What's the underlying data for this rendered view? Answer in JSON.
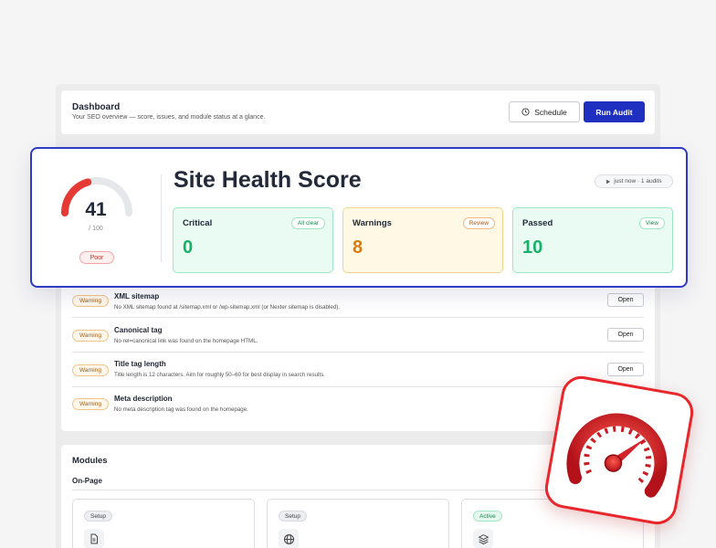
{
  "header": {
    "title": "Dashboard",
    "subtitle": "Your SEO overview — score, issues, and module status at a glance.",
    "schedule_label": "Schedule",
    "run_audit_label": "Run Audit"
  },
  "score": {
    "title": "Site Health Score",
    "value": "41",
    "max": "/ 100",
    "fraction": 0.41,
    "rating": "Poor",
    "meta": "just now · 1 audits",
    "stats": [
      {
        "label": "Critical",
        "value": "0",
        "pill": "All clear",
        "color": "#17b26a"
      },
      {
        "label": "Warnings",
        "value": "8",
        "pill": "Review",
        "color": "#db7a0b"
      },
      {
        "label": "Passed",
        "value": "10",
        "pill": "View",
        "color": "#17b26a"
      }
    ],
    "colors": {
      "accent": "#2f3ac7",
      "gauge_fill": "#e53935",
      "gauge_track": "#e6e7ea"
    }
  },
  "issues": [
    {
      "badge": "Warning",
      "title": "XML sitemap",
      "desc": "No XML sitemap found at /sitemap.xml or /wp-sitemap.xml (or Nexter sitemap is disabled).",
      "action": "Open"
    },
    {
      "badge": "Warning",
      "title": "Canonical tag",
      "desc": "No rel=canonical link was found on the homepage HTML.",
      "action": "Open"
    },
    {
      "badge": "Warning",
      "title": "Title tag length",
      "desc": "Title length is 12 characters. Aim for roughly 50–60 for best display in search results.",
      "action": "Open"
    },
    {
      "badge": "Warning",
      "title": "Meta description",
      "desc": "No meta description tag was found on the homepage.",
      "action": ""
    }
  ],
  "modules": {
    "title": "Modules",
    "section": "On-Page",
    "cards": [
      {
        "status": "Setup",
        "icon": "document-icon"
      },
      {
        "status": "Setup",
        "icon": "globe-icon"
      },
      {
        "status": "Active",
        "icon": "layers-icon"
      }
    ]
  }
}
